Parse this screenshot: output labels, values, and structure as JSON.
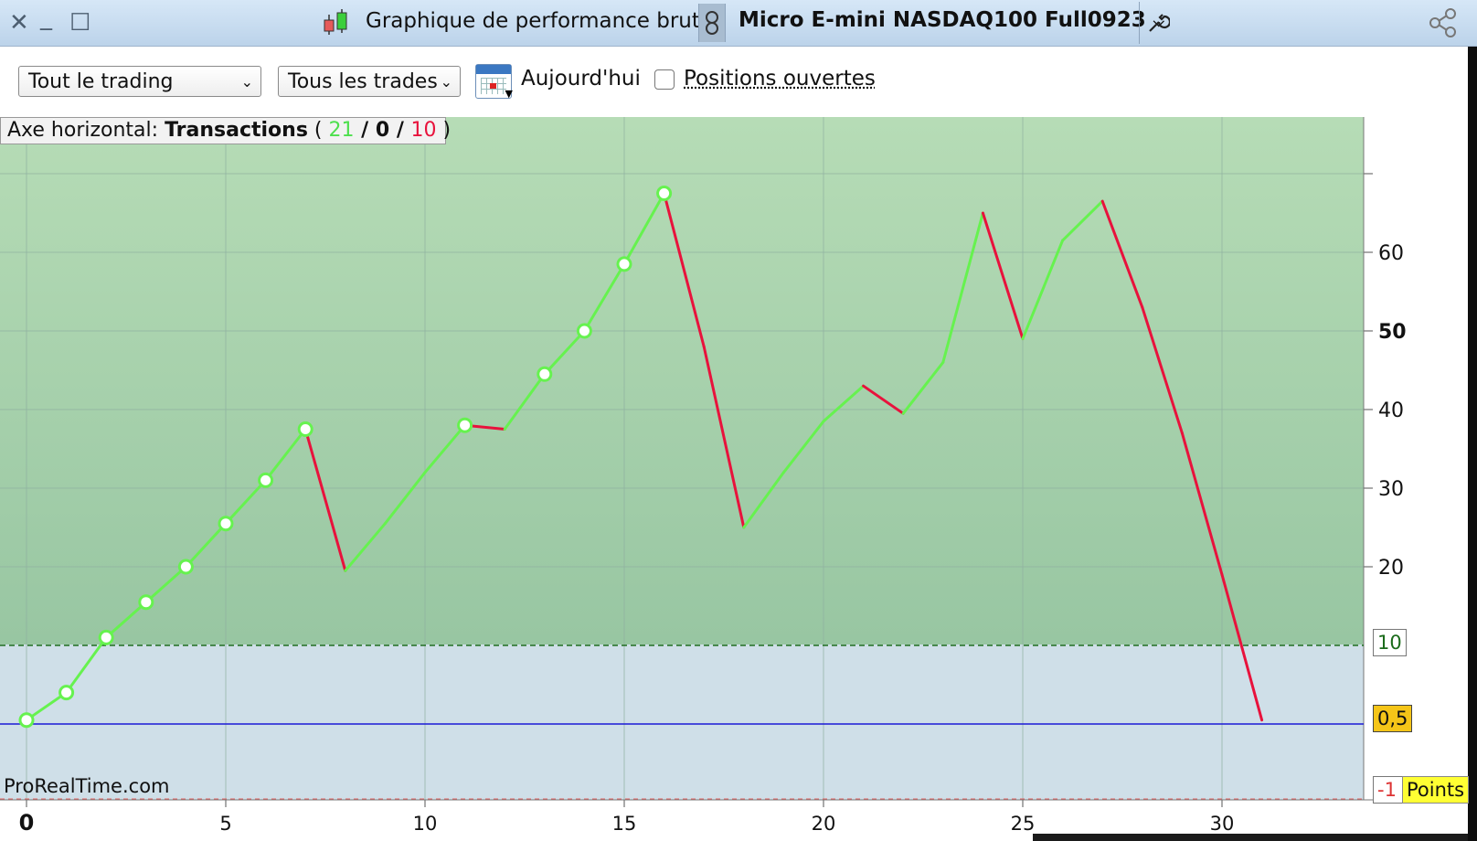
{
  "window": {
    "title": "Graphique de performance brute",
    "instrument": "Micro E-mini NASDAQ100 Full0923"
  },
  "toolbar": {
    "scope_select": "Tout le trading",
    "trades_select": "Tous les trades",
    "today_label": "Aujourd'hui",
    "open_positions_label": "Positions ouvertes",
    "open_positions_checked": false
  },
  "header": {
    "prefix": "Axe horizontal: ",
    "axis_name": "Transactions",
    "open_paren": " ( ",
    "wins": "21",
    "sep1": " / ",
    "neutral": "0",
    "sep2": " / ",
    "losses": "10",
    "close_paren": " )",
    "win_color": "#4ddf4d",
    "loss_color": "#e8123c"
  },
  "watermark": "ProRealTime.com",
  "right_labels": {
    "level_10": "10",
    "current": "0,5",
    "bottom": "-1",
    "units": "Points"
  },
  "chart_data": {
    "type": "line",
    "xlabel": "",
    "ylabel": "Points",
    "xlim": [
      0,
      33
    ],
    "ylim": [
      -9.5,
      70
    ],
    "x_ticks": [
      0,
      5,
      10,
      15,
      20,
      25,
      30
    ],
    "y_ticks": [
      20,
      30,
      40,
      50,
      60
    ],
    "bold_y_tick": 50,
    "reference_line": 10,
    "baseline": 0,
    "colors": {
      "gain": "#66f24f",
      "loss": "#e8123c",
      "baseline": "#1a1ad6",
      "reference": "#1b6b1b"
    },
    "series": [
      {
        "x": [
          0,
          1,
          2,
          3,
          4,
          5,
          6,
          7,
          8,
          9,
          10,
          11,
          12,
          13,
          14,
          15,
          16,
          17,
          18,
          19,
          20,
          21,
          22,
          23,
          24,
          25,
          26,
          27,
          28,
          29,
          30,
          31
        ],
        "y": [
          0.5,
          4,
          11,
          15.5,
          20,
          25.5,
          31,
          37.5,
          19.5,
          25.5,
          32,
          38,
          37.5,
          44.5,
          50,
          58.5,
          67.5,
          48,
          25,
          32,
          38.5,
          43,
          39.5,
          46,
          65,
          49,
          61.5,
          66.5,
          53,
          37,
          19,
          0.5
        ],
        "markers": [
          0,
          1,
          2,
          3,
          4,
          5,
          6,
          7,
          11,
          13,
          14,
          15,
          16
        ]
      }
    ]
  }
}
